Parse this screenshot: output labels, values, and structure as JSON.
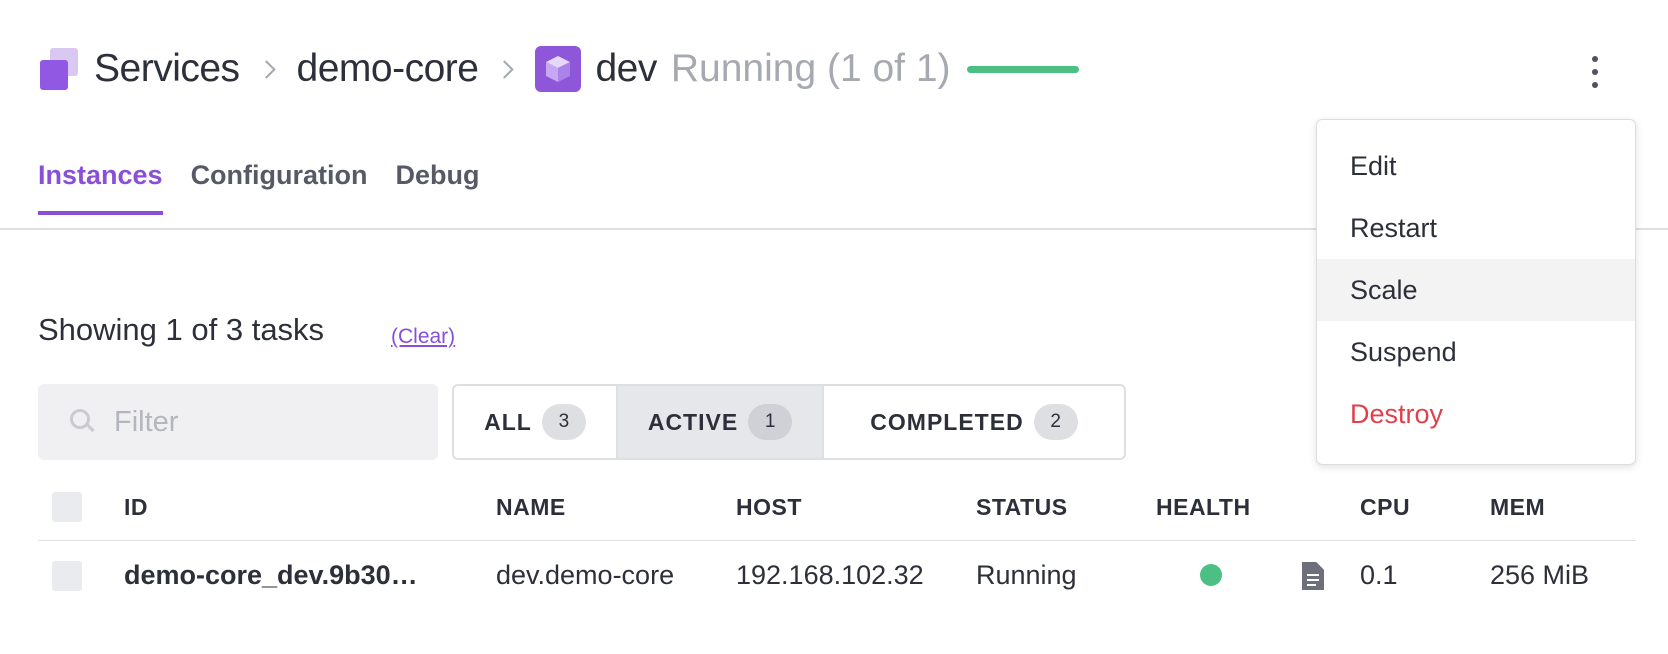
{
  "breadcrumb": {
    "services": "Services",
    "service": "demo-core",
    "pod": "dev",
    "status": "Running (1 of 1)",
    "progress": 1.0
  },
  "tabs": [
    {
      "label": "Instances",
      "active": true
    },
    {
      "label": "Configuration",
      "active": false
    },
    {
      "label": "Debug",
      "active": false
    }
  ],
  "summary": {
    "text": "Showing 1 of 3 tasks",
    "clear_label": "(Clear)"
  },
  "filter": {
    "placeholder": "Filter",
    "value": ""
  },
  "status_filters": [
    {
      "label": "ALL",
      "count": "3",
      "active": false
    },
    {
      "label": "ACTIVE",
      "count": "1",
      "active": true
    },
    {
      "label": "COMPLETED",
      "count": "2",
      "active": false
    }
  ],
  "table": {
    "columns": [
      "ID",
      "NAME",
      "HOST",
      "STATUS",
      "HEALTH",
      "CPU",
      "MEM"
    ],
    "rows": [
      {
        "id": "demo-core_dev.9b30…",
        "name": "dev.demo-core",
        "host": "192.168.102.32",
        "status": "Running",
        "health": "healthy",
        "cpu": "0.1",
        "mem": "256 MiB"
      }
    ]
  },
  "menu": {
    "items": [
      {
        "label": "Edit",
        "hover": false,
        "danger": false
      },
      {
        "label": "Restart",
        "hover": false,
        "danger": false
      },
      {
        "label": "Scale",
        "hover": true,
        "danger": false
      },
      {
        "label": "Suspend",
        "hover": false,
        "danger": false
      },
      {
        "label": "Destroy",
        "hover": false,
        "danger": true
      }
    ]
  },
  "colors": {
    "accent": "#8a4fd6",
    "healthy": "#4cbf84",
    "danger": "#e0404a"
  },
  "icons": [
    "services-icon",
    "chevron-right-icon",
    "pod-cube-icon",
    "more-vertical-icon",
    "search-icon",
    "log-file-icon",
    "health-status-icon"
  ]
}
